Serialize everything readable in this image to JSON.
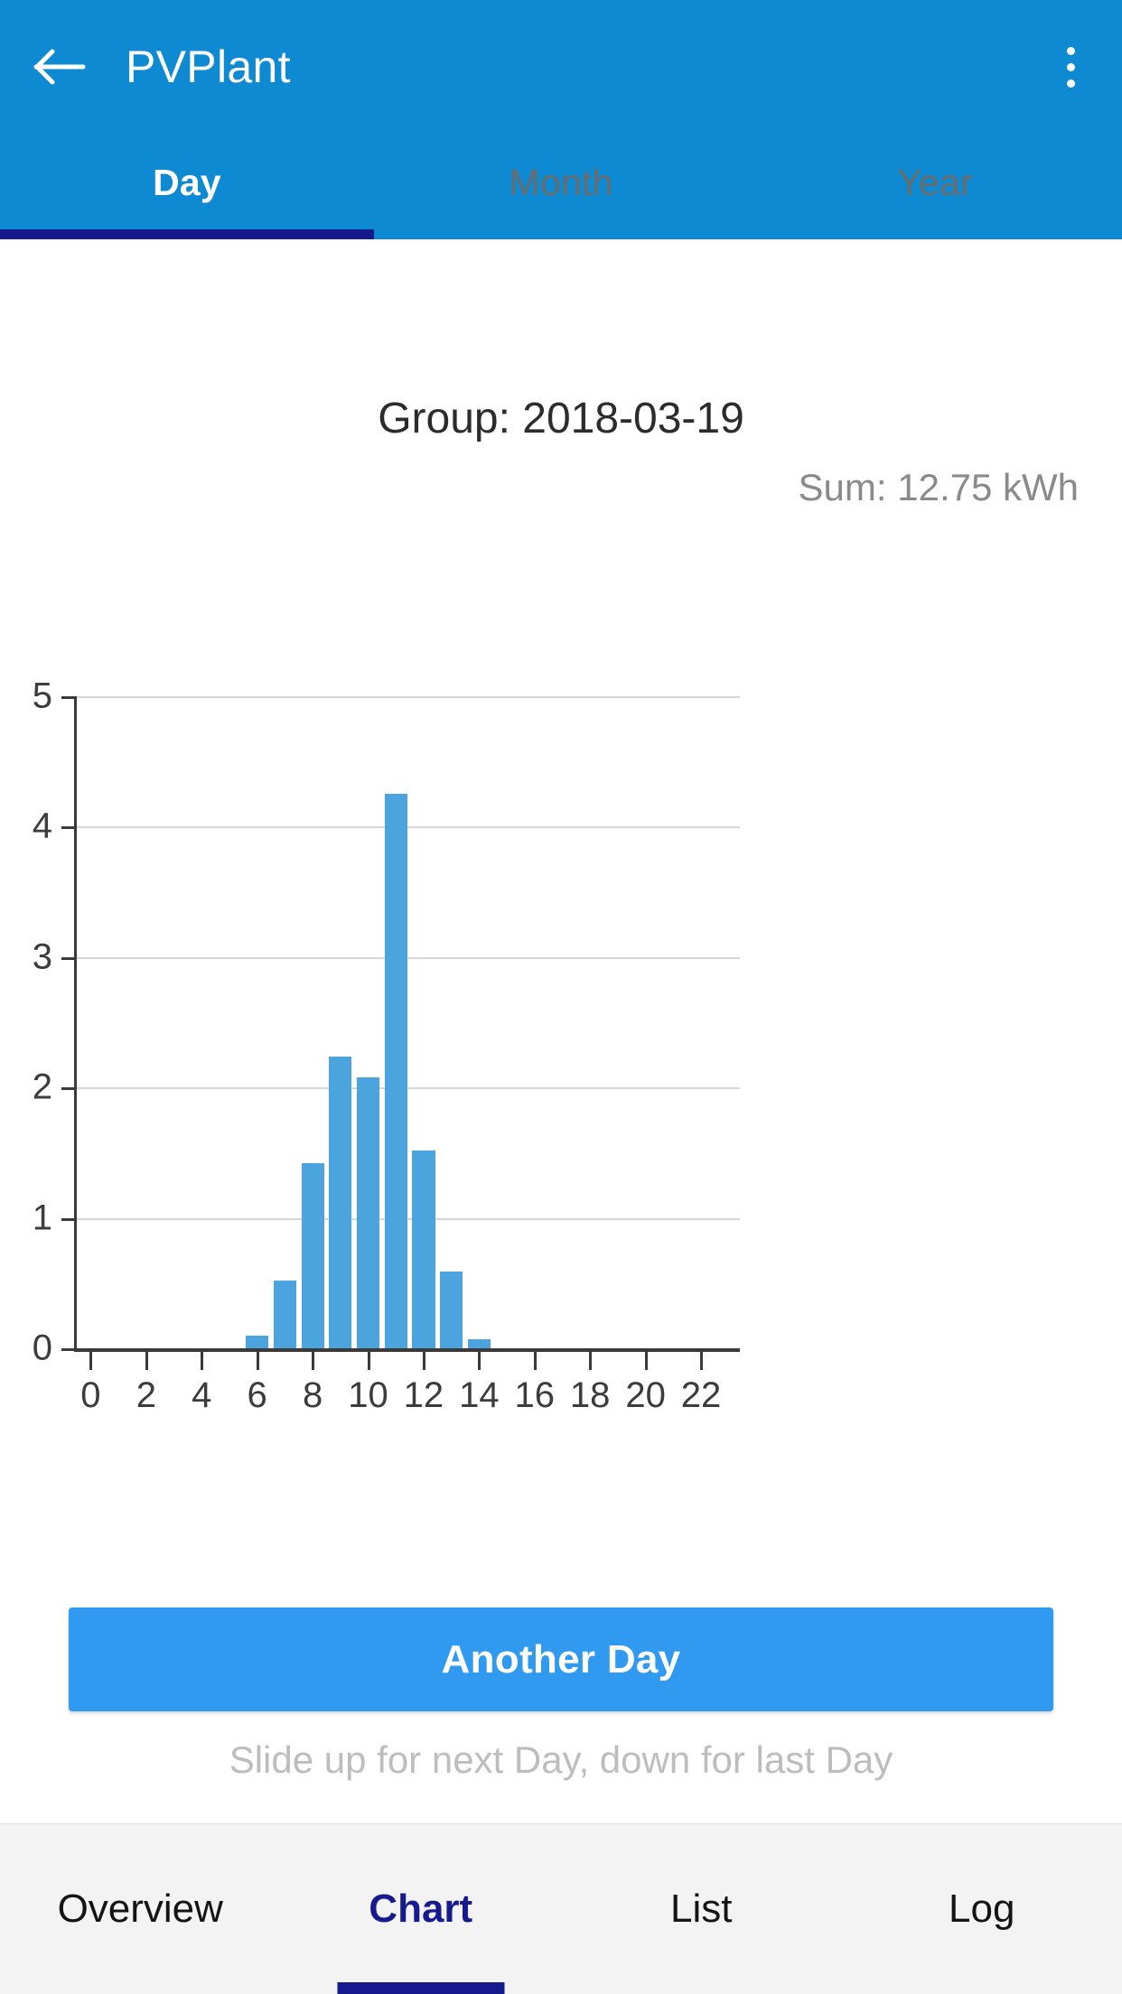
{
  "appbar": {
    "title": "PVPlant",
    "back_icon": "arrow-left-icon",
    "overflow_icon": "more-vertical-icon",
    "background_color": "#0d8ad1"
  },
  "tabs": {
    "items": [
      {
        "label": "Day",
        "active": true
      },
      {
        "label": "Month",
        "active": false
      },
      {
        "label": "Year",
        "active": false
      }
    ],
    "indicator_color": "#151a8e"
  },
  "chart_header": {
    "group_label": "Group: 2018-03-19",
    "sum_label": "Sum: 12.75 kWh"
  },
  "actions": {
    "another_day_label": "Another Day",
    "another_day_color": "#2f9af0",
    "slide_hint": "Slide up for next Day, down for last Day"
  },
  "bottom_nav": {
    "items": [
      {
        "label": "Overview",
        "active": false
      },
      {
        "label": "Chart",
        "active": true
      },
      {
        "label": "List",
        "active": false
      },
      {
        "label": "Log",
        "active": false
      }
    ],
    "active_color": "#151a8e"
  },
  "chart_data": {
    "type": "bar",
    "title": "Group: 2018-03-19",
    "subtitle": "Sum: 12.75 kWh",
    "xlabel": "",
    "ylabel": "",
    "unit": "kWh",
    "bar_color": "#4ba4dd",
    "grid": true,
    "legend": "none",
    "xlim": [
      -0.6,
      23.4
    ],
    "ylim": [
      0,
      5
    ],
    "xticks": [
      0,
      2,
      4,
      6,
      8,
      10,
      12,
      14,
      16,
      18,
      20,
      22
    ],
    "yticks": [
      0,
      1,
      2,
      3,
      4,
      5
    ],
    "xtick_labels": [
      "0",
      "2",
      "4",
      "6",
      "8",
      "10",
      "12",
      "14",
      "16",
      "18",
      "20",
      "22"
    ],
    "ytick_labels": [
      "0",
      "1",
      "2",
      "3",
      "4",
      "5"
    ],
    "categories": [
      0,
      1,
      2,
      3,
      4,
      5,
      6,
      7,
      8,
      9,
      10,
      11,
      12,
      13,
      14,
      15,
      16,
      17,
      18,
      19,
      20,
      21,
      22,
      23
    ],
    "values": [
      0,
      0,
      0,
      0,
      0,
      0,
      0.1,
      0.52,
      1.42,
      2.24,
      2.08,
      4.25,
      1.52,
      0.59,
      0.07,
      0,
      0,
      0,
      0,
      0,
      0,
      0,
      0,
      0
    ],
    "sum": 12.75
  }
}
